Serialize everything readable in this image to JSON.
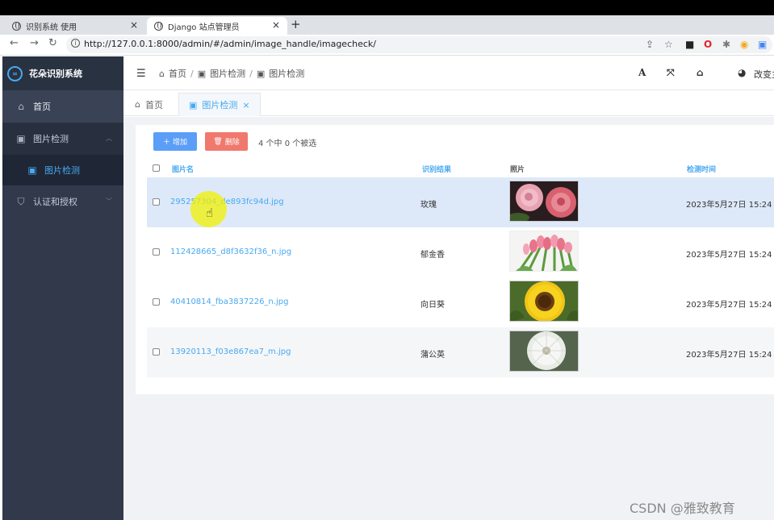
{
  "browser": {
    "tabs": [
      {
        "title": "识别系统 使用"
      },
      {
        "title": "Django 站点管理员"
      }
    ],
    "new_tab": "+",
    "close": "×",
    "url": "http://127.0.0.1:8000/admin/#/admin/image_handle/imagecheck/"
  },
  "app": {
    "logo": "∞",
    "title": "花朵识别系统"
  },
  "sidebar": {
    "home": "首页",
    "group": "图片检测",
    "sub_item": "图片检测",
    "auth": "认证和授权"
  },
  "header": {
    "breadcrumb": [
      "首页",
      "图片检测",
      "图片检测"
    ],
    "font_icon": "A",
    "change_theme": "改变主题"
  },
  "tabs": {
    "home": "首页",
    "current": "图片检测",
    "close": "×"
  },
  "toolbar": {
    "add": "增加",
    "delete": "删除",
    "selection": "4 个中 0 个被选"
  },
  "table": {
    "columns": [
      "图片名",
      "识别结果",
      "照片",
      "检测时间"
    ],
    "rows": [
      {
        "name": "295257304_de893fc94d.jpg",
        "result": "玫瑰",
        "time": "2023年5月27日 15:24",
        "photo": "rose"
      },
      {
        "name": "112428665_d8f3632f36_n.jpg",
        "result": "郁金香",
        "time": "2023年5月27日 15:24",
        "photo": "tulip"
      },
      {
        "name": "40410814_fba3837226_n.jpg",
        "result": "向日葵",
        "time": "2023年5月27日 15:24",
        "photo": "sunflower"
      },
      {
        "name": "13920113_f03e867ea7_m.jpg",
        "result": "蒲公英",
        "time": "2023年5月27日 15:24",
        "photo": "dandelion"
      }
    ]
  },
  "watermark": "CSDN @雅致教育"
}
